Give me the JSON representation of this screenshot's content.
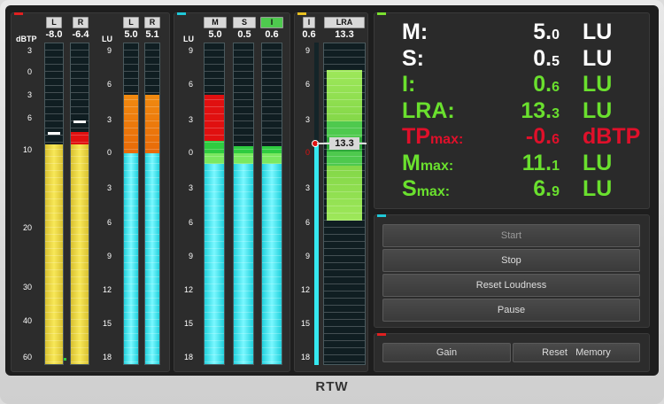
{
  "colors": {
    "yellow": "#f5e04a",
    "cyan": "#35e8f0",
    "orange": "#f08a10",
    "red": "#e01010",
    "green": "#2ecc40",
    "lightgreen": "#9ee85a",
    "text_green": "#6ae02e",
    "text_red": "#e0102a"
  },
  "tp_section": {
    "unit_label": "dBTP",
    "channels": [
      {
        "label": "L",
        "value": "-8.0",
        "level_dbtp": -8.0
      },
      {
        "label": "R",
        "value": "-6.4",
        "level_dbtp": -6.4
      }
    ],
    "scale": [
      "3",
      "0",
      "3",
      "6",
      "10",
      "20",
      "30",
      "40",
      "60"
    ]
  },
  "lr_section": {
    "unit_label": "LU",
    "channels": [
      {
        "label": "L",
        "value": "5.0",
        "level_lu": 5.0
      },
      {
        "label": "R",
        "value": "5.1",
        "level_lu": 5.1
      }
    ],
    "scale": [
      "9",
      "6",
      "3",
      "0",
      "3",
      "6",
      "9",
      "12",
      "15",
      "18"
    ]
  },
  "msi_section": {
    "unit_label": "LU",
    "channels": [
      {
        "label": "M",
        "value": "5.0",
        "level_lu": 5.0
      },
      {
        "label": "S",
        "value": "0.5",
        "level_lu": 0.5
      },
      {
        "label": "I",
        "value": "0.6",
        "level_lu": 0.6
      }
    ],
    "scale": [
      "9",
      "6",
      "3",
      "0",
      "3",
      "6",
      "9",
      "12",
      "15",
      "18"
    ]
  },
  "lra_section": {
    "i_label": "I",
    "i_value": "0.6",
    "lra_label": "LRA",
    "lra_value": "13.3",
    "lra_marker": "13.3",
    "scale": [
      "9",
      "6",
      "3",
      "0",
      "3",
      "6",
      "9",
      "12",
      "15",
      "18"
    ]
  },
  "readout": {
    "rows": [
      {
        "label": "M:",
        "sub": "",
        "big": "5.",
        "small": "0",
        "unit": "LU",
        "color": "#ffffff"
      },
      {
        "label": "S:",
        "sub": "",
        "big": "0.",
        "small": "5",
        "unit": "LU",
        "color": "#ffffff"
      },
      {
        "label": "I:",
        "sub": "",
        "big": "0.",
        "small": "6",
        "unit": "LU",
        "color": "#6ae02e"
      },
      {
        "label": "LRA:",
        "sub": "",
        "big": "13.",
        "small": "3",
        "unit": "LU",
        "color": "#6ae02e"
      },
      {
        "label": "TP",
        "sub": "max:",
        "big": "-0.",
        "small": "6",
        "unit": "dBTP",
        "color": "#e0102a"
      },
      {
        "label": "M",
        "sub": "max:",
        "big": "11.",
        "small": "1",
        "unit": "LU",
        "color": "#6ae02e"
      },
      {
        "label": "S",
        "sub": "max:",
        "big": "6.",
        "small": "9",
        "unit": "LU",
        "color": "#6ae02e"
      }
    ]
  },
  "controls": {
    "start": "Start",
    "stop": "Stop",
    "reset_loudness": "Reset Loudness",
    "pause": "Pause"
  },
  "bottom": {
    "gain": "Gain",
    "reset_memory": "Reset   Memory"
  },
  "brand": {
    "logo_text": "RTW"
  }
}
